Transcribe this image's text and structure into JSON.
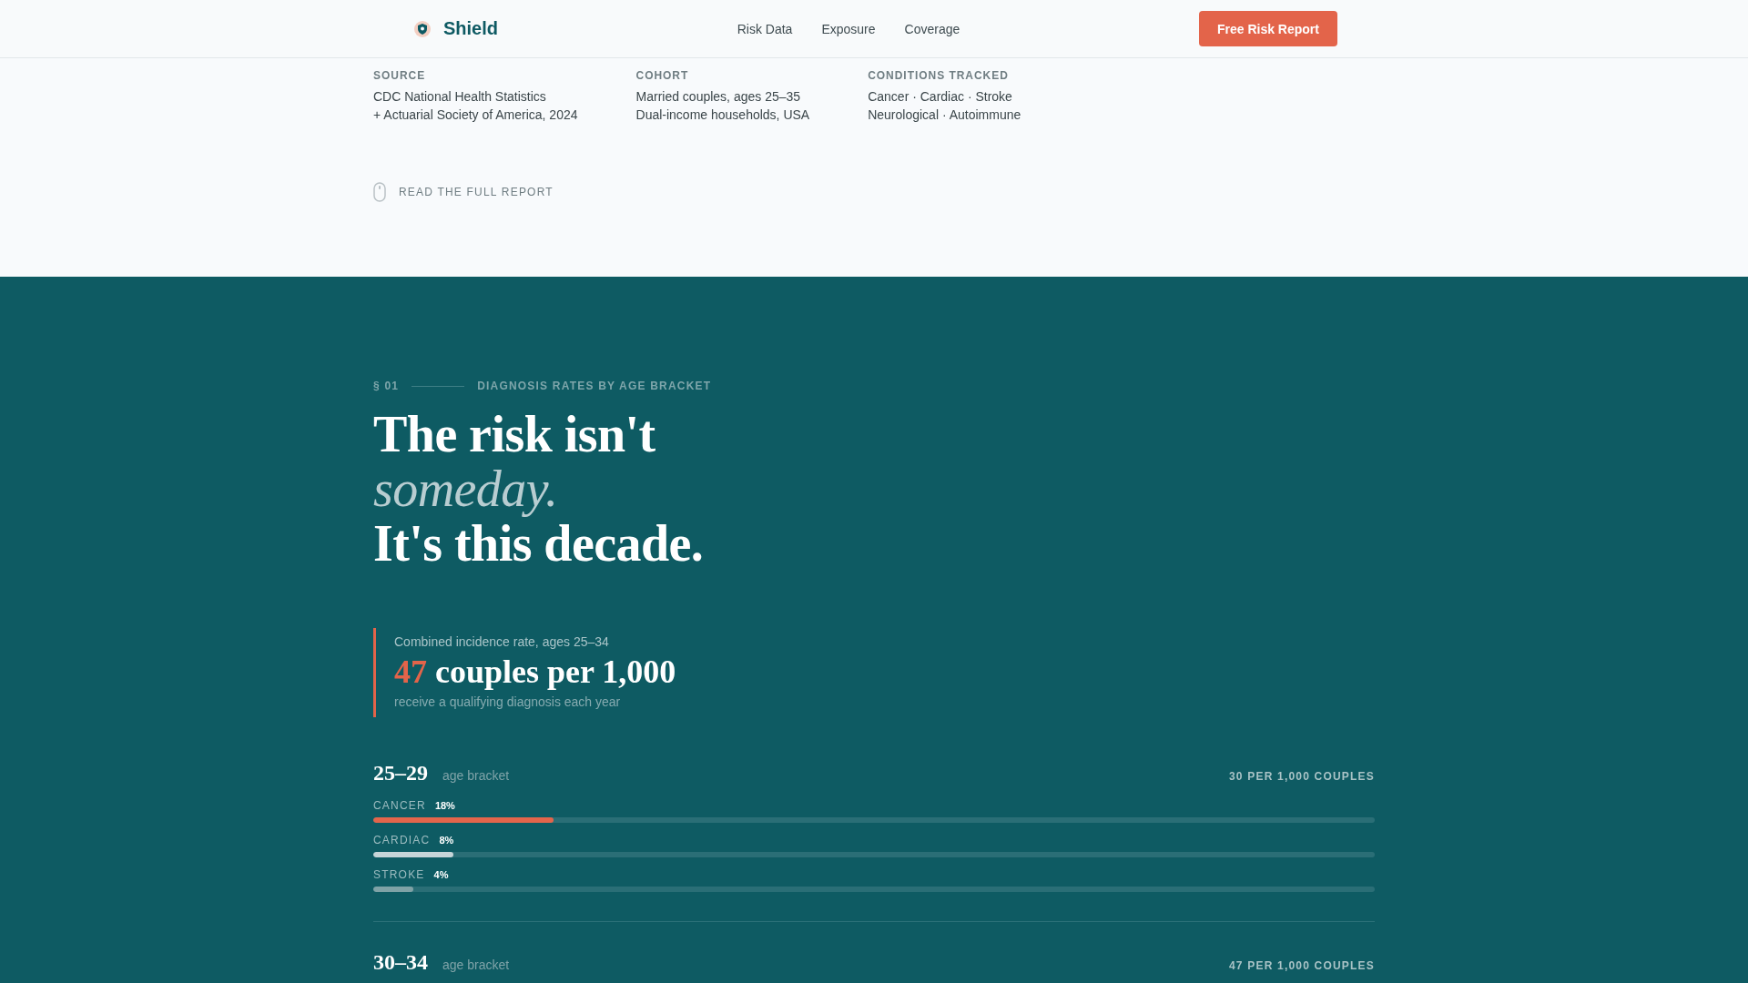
{
  "header": {
    "logo": "Shield",
    "nav": [
      "Risk Data",
      "Exposure",
      "Coverage"
    ],
    "cta": "Free Risk Report"
  },
  "intro": {
    "meta": [
      {
        "label": "SOURCE",
        "lines": [
          "CDC National Health Statistics",
          "+ Actuarial Society of America, 2024"
        ]
      },
      {
        "label": "COHORT",
        "lines": [
          "Married couples, ages 25–35",
          "Dual-income households, USA"
        ]
      },
      {
        "label": "CONDITIONS TRACKED",
        "lines": [
          "Cancer · Cardiac · Stroke",
          "Neurological · Autoimmune"
        ]
      }
    ],
    "scroll_hint": "READ THE FULL REPORT"
  },
  "section": {
    "number": "§ 01",
    "eyebrow": "DIAGNOSIS RATES BY AGE BRACKET",
    "heading": [
      "The risk isn't",
      "*someday.*",
      "It's this decade."
    ],
    "stat": {
      "label": "Combined incidence rate, ages 25–34",
      "value": "47",
      "unit": "couples per 1,000",
      "note": "receive a qualifying diagnosis each year"
    },
    "brackets": [
      {
        "range": "25–29",
        "caption": "age bracket",
        "rate": "30 PER 1,000 COUPLES",
        "bars": [
          {
            "label": "CANCER",
            "reading": "18%",
            "level": 0.18,
            "color": "#e3654b"
          },
          {
            "label": "CARDIAC",
            "reading": "8%",
            "level": 0.08,
            "color": "#c6d5d8"
          },
          {
            "label": "STROKE",
            "reading": "4%",
            "level": 0.04,
            "color": "#7fa2a6"
          }
        ]
      },
      {
        "range": "30–34",
        "caption": "age bracket",
        "rate": "47 PER 1,000 COUPLES"
      }
    ]
  }
}
